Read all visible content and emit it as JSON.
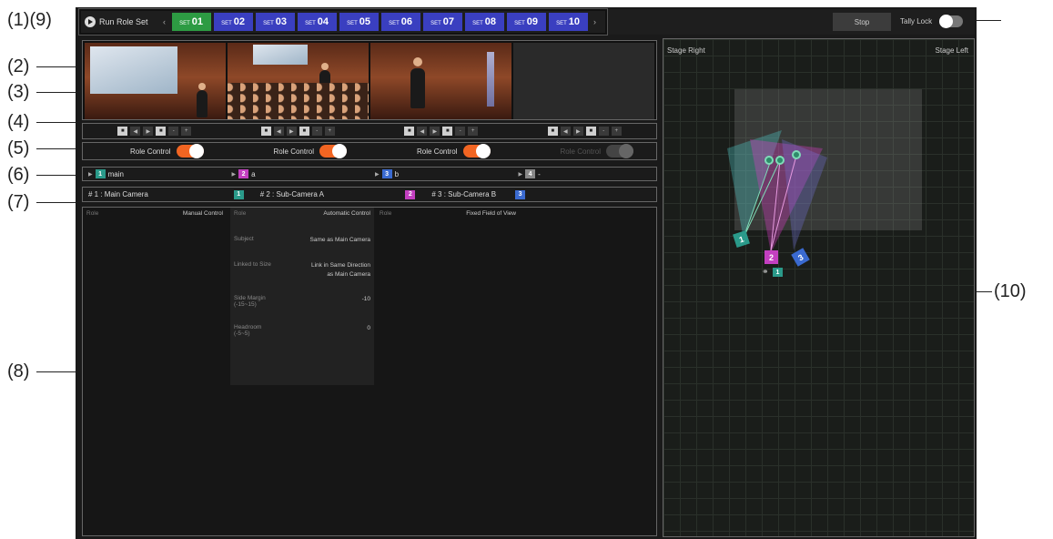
{
  "callouts": {
    "c1_9": "(1)(9)",
    "c2": "(2)",
    "c3": "(3)",
    "c4": "(4)",
    "c5": "(5)",
    "c6": "(6)",
    "c7": "(7)",
    "c8": "(8)",
    "c10": "(10)"
  },
  "topbar": {
    "run_label": "Run Role Set",
    "prev_arrow": "‹",
    "next_arrow": "›",
    "set_prefix": "SET",
    "sets": [
      "01",
      "02",
      "03",
      "04",
      "05",
      "06",
      "07",
      "08",
      "09",
      "10"
    ],
    "active_set": "01",
    "stop_label": "Stop",
    "tally_label": "Tally Lock"
  },
  "ptz": {
    "left": "◀",
    "right": "▶",
    "minus": "-",
    "plus": "+"
  },
  "role_control": {
    "label": "Role Control"
  },
  "groups": [
    {
      "num": "1",
      "name": "main",
      "color": "#2a9a8a"
    },
    {
      "num": "2",
      "name": "a",
      "color": "#c33fc0"
    },
    {
      "num": "3",
      "name": "b",
      "color": "#3a6ad0"
    },
    {
      "num": "4",
      "name": "-",
      "color": "#888888"
    }
  ],
  "cameras": [
    {
      "label": "# 1 : Main Camera",
      "badge": "1",
      "color": "#2a9a8a"
    },
    {
      "label": "# 2 : Sub-Camera A",
      "badge": "2",
      "color": "#c33fc0"
    },
    {
      "label": "# 3 : Sub-Camera B",
      "badge": "3",
      "color": "#3a6ad0"
    }
  ],
  "roles": {
    "role_key": "Role",
    "col1_val": "Manual Control",
    "col2_val": "Automatic Control",
    "col3_val": "Fixed Field of View",
    "subject_k": "Subject",
    "subject_v": "Same as Main Camera",
    "linked_k": "Linked to Size",
    "linked_v": "Link in Same Direction as Main Camera",
    "side_k": "Side Margin",
    "side_range": "(-15~15)",
    "side_v": "-10",
    "head_k": "Headroom",
    "head_range": "(-5~5)",
    "head_v": "0"
  },
  "stage": {
    "right_label": "Stage Right",
    "left_label": "Stage Left",
    "link_badge": "1"
  }
}
